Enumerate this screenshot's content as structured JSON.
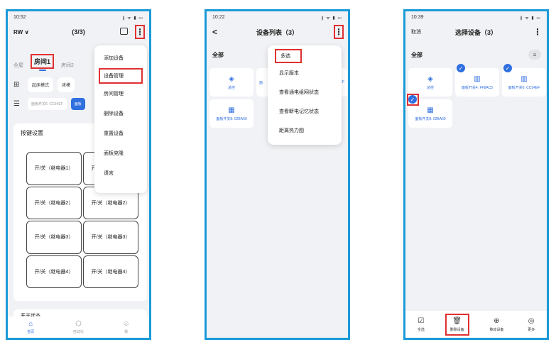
{
  "phone1": {
    "time": "10:52",
    "status_icons": "∦ ᯤ ▮ ▭",
    "home_selector": "RW ∨",
    "page_count": "(3/3)",
    "more_icon": "⋮",
    "room_tabs": [
      "全屋",
      "房间1",
      "房间2"
    ],
    "mode_chips": [
      "起床模式",
      "床模"
    ],
    "filter_chips": [
      "面板开关6: CC54EF",
      "面板"
    ],
    "key_card_title": "按键设置",
    "keys": [
      "开/关（继电器1）",
      "开/关（继电器1）",
      "开/关（继电器2）",
      "开/关（继电器2）",
      "开/关（继电器3）",
      "开/关（继电器3）",
      "开/关（继电器4）",
      "开/关（继电器4）"
    ],
    "bottom_card_text": "开关状态",
    "menu_items": [
      "添加设备",
      "设备管理",
      "房间管理",
      "删除设备",
      "重置设备",
      "面板克隆",
      "语言"
    ],
    "tabs": [
      {
        "label": "首页",
        "icon": "⌂"
      },
      {
        "label": "自动化",
        "icon": "⬡"
      },
      {
        "label": "我",
        "icon": "☺"
      }
    ],
    "highlight_color": "#e03131"
  },
  "phone2": {
    "time": "10:22",
    "status_icons": "∦ ᯤ ▮ ▭",
    "back_icon": "<",
    "title": "设备列表（3）",
    "more_icon": "⋮",
    "section_label": "全部",
    "grid_icon": "≡",
    "tiles": [
      {
        "label": "总控",
        "icon": "◈"
      },
      {
        "label": "面板开关8: 02BA69",
        "icon": "▦"
      }
    ],
    "hidden_tile_fragments": [
      "面",
      "EF"
    ],
    "menu_items": [
      "多选",
      "显示版本",
      "查看通电组网状态",
      "查看断电记忆状态",
      "距离热力图"
    ]
  },
  "phone3": {
    "time": "10:39",
    "status_icons": "∦ ᯤ ▮ ▭",
    "cancel": "取消",
    "title": "选择设备（3）",
    "more_icon": "⋮",
    "section_label": "全部",
    "grid_icon": "≡",
    "tiles": [
      {
        "label": "总控",
        "icon": "◈"
      },
      {
        "label": "面板开关4: FF8AC5",
        "icon": "▥"
      },
      {
        "label": "面板开关6: CC54EF",
        "icon": "▥"
      },
      {
        "label": "面板开关8: 02BA69",
        "icon": "▦"
      }
    ],
    "check_mark": "✓",
    "actions": [
      {
        "label": "全选",
        "icon": "☑"
      },
      {
        "label": "删除设备",
        "icon": "🗑"
      },
      {
        "label": "移动设备",
        "icon": "⊕"
      },
      {
        "label": "更多",
        "icon": "◎"
      }
    ]
  }
}
